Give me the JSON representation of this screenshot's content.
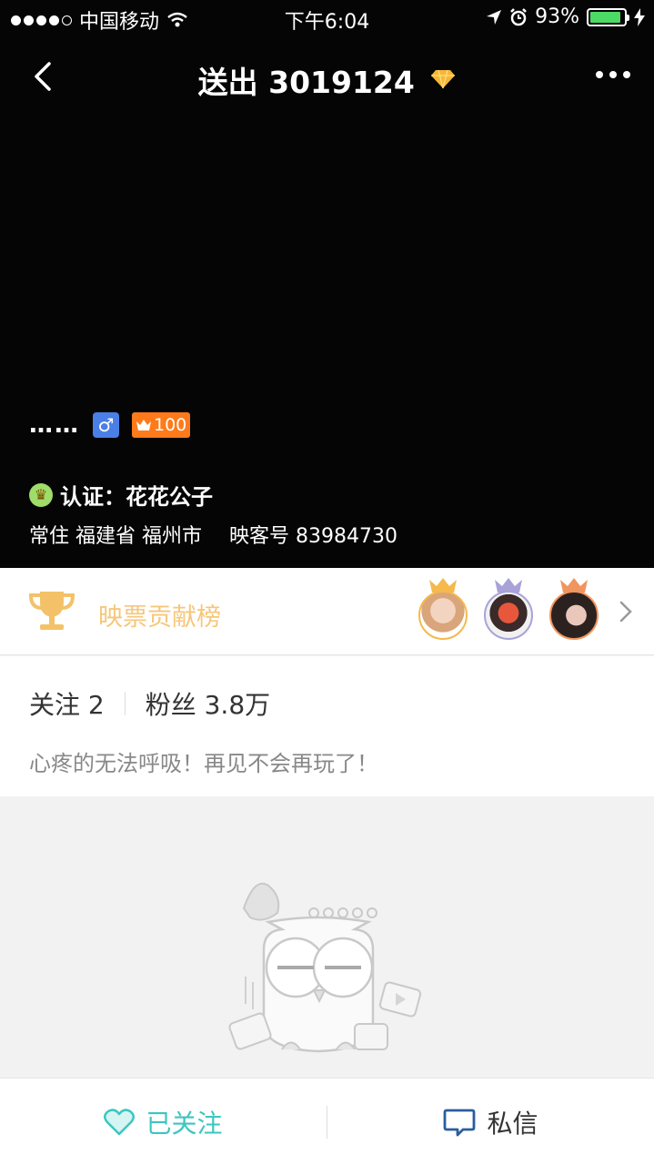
{
  "status_bar": {
    "carrier": "中国移动",
    "time": "下午6:04",
    "battery": "93%",
    "battery_level": 0.93
  },
  "nav": {
    "title_prefix": "送出",
    "sent_count": "3019124"
  },
  "profile": {
    "nickname": "……",
    "gender_symbol": "♂",
    "level": "100",
    "verify_label": "认证：花花公子",
    "location": "常住 福建省 福州市",
    "user_id": "映客号 83984730"
  },
  "ranking": {
    "label": "映票贡献榜",
    "colors": {
      "first": "#f5b94c",
      "second": "#a9a2d8",
      "third": "#f0955e"
    }
  },
  "stats": {
    "following": "关注 2",
    "fans": "粉丝 3.8万",
    "bio": "心疼的无法呼吸！再见不会再玩了！"
  },
  "bottom_bar": {
    "follow_label": "已关注",
    "message_label": "私信"
  },
  "colors": {
    "accent_teal": "#3cc6c0",
    "gold": "#f6c77a",
    "header_bg": "#050505"
  }
}
